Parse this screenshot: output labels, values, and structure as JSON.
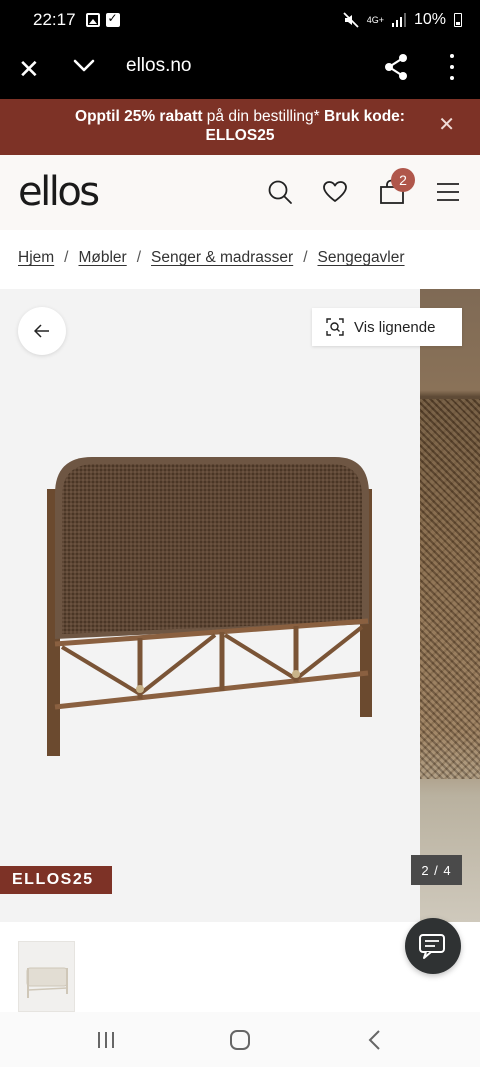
{
  "status_bar": {
    "time": "22:17",
    "left_icons": [
      "gallery-icon",
      "checkbox-icon"
    ],
    "network": "4G+",
    "battery": "10%",
    "right_icons": [
      "mute-icon",
      "signal-icon",
      "battery-icon"
    ]
  },
  "browser": {
    "url": "ellos.no",
    "icons": [
      "close-icon",
      "chevron-down-icon",
      "share-icon",
      "more-icon"
    ]
  },
  "promo": {
    "line1_bold": "Opptil 25% rabatt",
    "line1_text": " på din bestilling* ",
    "line1_bold2": "Bruk kode:",
    "code": "ELLOS25",
    "close_symbol": "✕"
  },
  "header": {
    "logo": "ellos",
    "cart_count": "2",
    "icons": [
      "search-icon",
      "heart-icon",
      "bag-icon",
      "menu-icon"
    ]
  },
  "breadcrumb": {
    "items": [
      "Hjem",
      "Møbler",
      "Senger & madrasser",
      "Sengegavler"
    ],
    "separator": "/"
  },
  "gallery": {
    "similar_label": "Vis lignende",
    "code_tag": "ELLOS25",
    "counter": "2 / 4"
  },
  "colors": {
    "brand": "#7d3226",
    "badge": "#b0574b",
    "header_bg": "#faf8f6",
    "chat_bg": "#2f3233"
  }
}
